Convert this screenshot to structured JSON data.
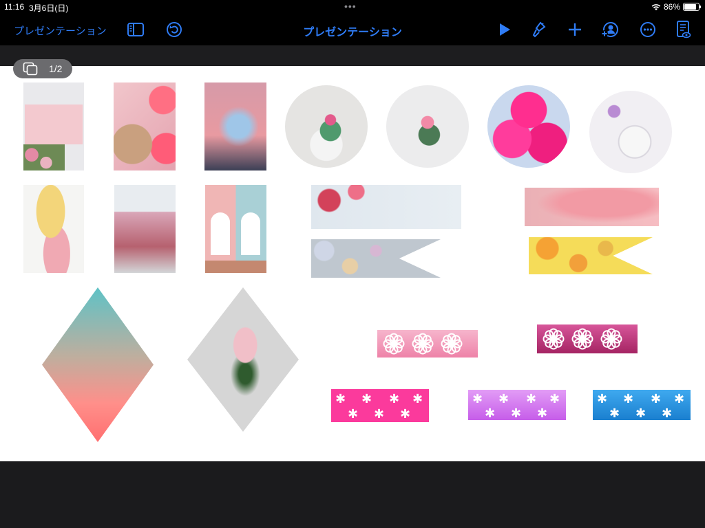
{
  "status": {
    "time": "11:16",
    "date": "3月6日(日)",
    "battery": "86%",
    "battery_level": 0.86
  },
  "toolbar": {
    "back_label": "プレゼンテーション",
    "title": "プレゼンテーション",
    "icons": [
      "sidebar-icon",
      "undo-icon",
      "play-icon",
      "format-brush-icon",
      "add-icon",
      "collaborate-icon",
      "more-icon",
      "reading-view-icon"
    ]
  },
  "slide_counter": "1/2",
  "colors": {
    "accent": "#2f7cf6",
    "toolbar_bg": "#000000",
    "canvas_bg": "#ffffff",
    "dark_bg": "#1b1b1d",
    "tape_light_pink": "#f199b6",
    "tape_dark_pink": "#b42c70",
    "tape_hot_pink": "#fb3a9c",
    "tape_violet": "#d671f2",
    "tape_blue": "#1f8fdc"
  },
  "slide_items": [
    "pink-card-with-roses-photo",
    "macarons-and-gerberas-photo",
    "fairy-light-jar-photo",
    "cactus-in-mug-photo",
    "rose-bouquet-on-white-photo",
    "pink-umbrellas-photo",
    "white-plate-with-petals-photo",
    "easter-eggs-photo",
    "pink-milkshake-photo",
    "colorful-doors-photo",
    "roses-on-paper-banner-photo",
    "pink-smoke-banner-photo",
    "pastel-eggs-ribbon-photo",
    "orange-slices-ribbon-photo",
    "fairy-jar-diamond-photo",
    "rose-bouquet-diamond-photo",
    "flower-tape-light-pink",
    "flower-tape-dark-pink",
    "snowflake-tape-hot-pink",
    "snowflake-tape-violet",
    "snowflake-tape-blue"
  ]
}
